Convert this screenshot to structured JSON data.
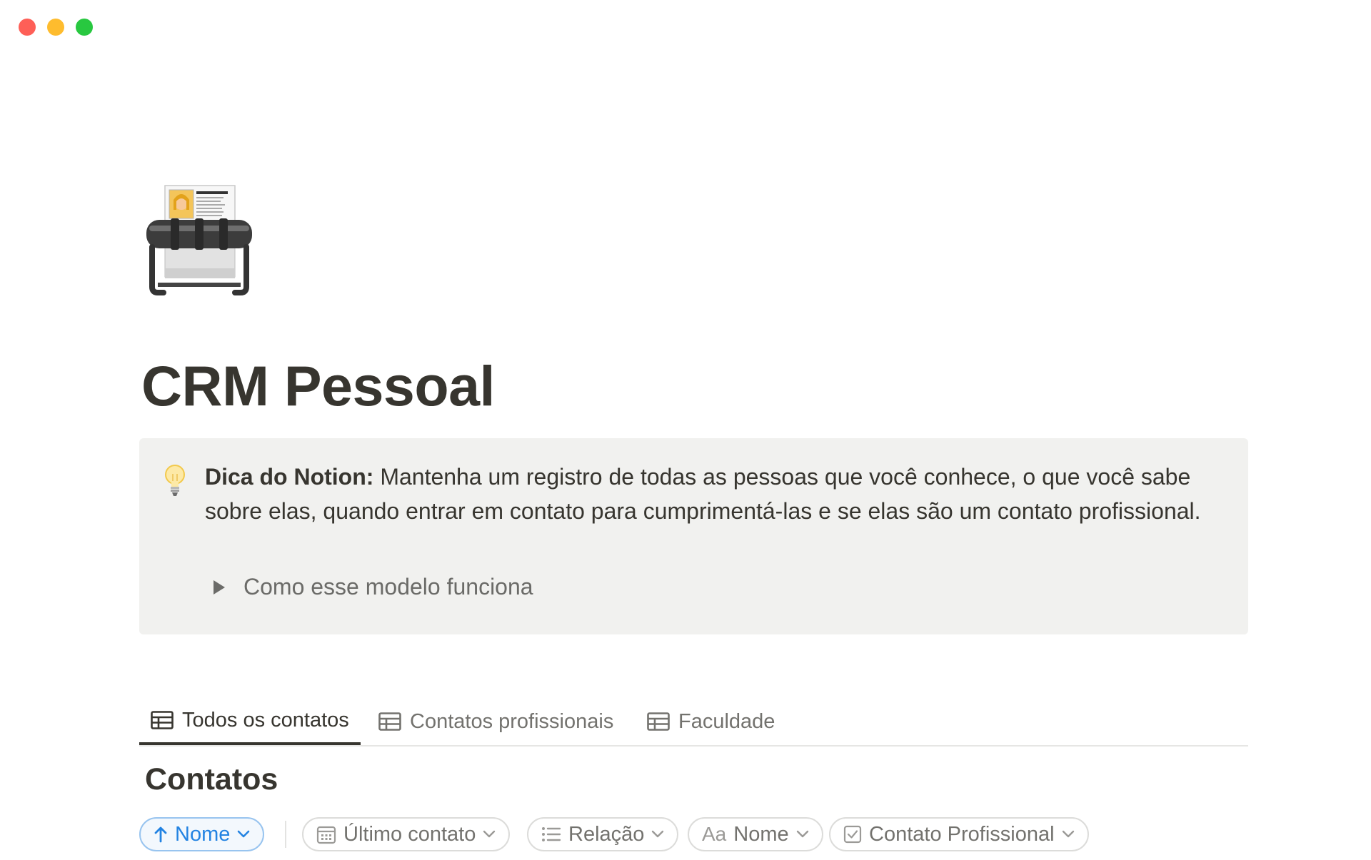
{
  "page": {
    "title": "CRM Pessoal",
    "icon": "rolodex-card-icon"
  },
  "callout": {
    "icon": "light-bulb-icon",
    "bold": "Dica do Notion:",
    "text": " Mantenha um registro de todas as pessoas que você conhece, o que você sabe sobre elas, quando entrar em contato para cumprimentá-las e se elas são um contato profissional.",
    "toggle_label": "Como esse modelo funciona"
  },
  "tabs": [
    {
      "label": "Todos os contatos",
      "icon": "table-icon",
      "active": true
    },
    {
      "label": "Contatos profissionais",
      "icon": "table-icon",
      "active": false
    },
    {
      "label": "Faculdade",
      "icon": "table-icon",
      "active": false
    }
  ],
  "database": {
    "title": "Contatos"
  },
  "filters": {
    "sort": {
      "label": "Nome",
      "icon": "arrow-up-icon"
    },
    "chips": [
      {
        "label": "Último contato",
        "icon": "calendar-icon"
      },
      {
        "label": "Relação",
        "icon": "list-icon"
      },
      {
        "label": "Nome",
        "icon": "text-aa-icon",
        "prefix": "Aa"
      },
      {
        "label": "Contato Profissional",
        "icon": "checkbox-icon"
      }
    ]
  },
  "colors": {
    "accent": "#2383e2",
    "callout_bg": "#f1f1ef",
    "text": "#37352f"
  }
}
